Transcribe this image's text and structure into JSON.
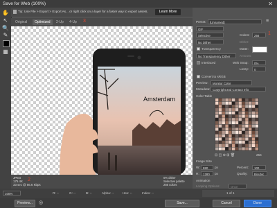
{
  "window": {
    "title": "Save for Web (100%)"
  },
  "tip": {
    "text": "Tip: Use File > Export > Export As... or right click on a layer for a faster way to export assets.",
    "button": "Learn More"
  },
  "tabs": [
    "Original",
    "Optimized",
    "2-Up",
    "4-Up"
  ],
  "annotations": {
    "a1": "3",
    "a2": "2",
    "a3": "1"
  },
  "image": {
    "caption": "Amsterdam"
  },
  "info": {
    "left1": "JPEG",
    "left2": "175.4K",
    "left3": "33 sec @ 56.6 Kbps",
    "right1": "0% dither",
    "right2": "Selective palette",
    "right3": "256 colors"
  },
  "bottom": {
    "zoom": "100%",
    "r": "R: --",
    "g": "G: --",
    "b": "B: --",
    "alpha": "Alpha: --",
    "hex": "Hex: --",
    "index": "Index: --",
    "preview_btn": "Preview...",
    "save_btn": "Save...",
    "cancel_btn": "Cancel",
    "done_btn": "Done"
  },
  "panel": {
    "preset_label": "Preset:",
    "preset_value": "[Unnamed]",
    "format_value": "GIF",
    "reduction_value": "Selective",
    "colors_label": "Colors:",
    "colors_value": "256",
    "dither_value": "No Dither",
    "dither_label": "Dither:",
    "transparency_label": "Transparency",
    "matte_label": "Matte:",
    "transparency_dither_value": "No Transparency Dither",
    "amount_label": "Amount:",
    "interlaced_label": "Interlaced",
    "websnap_label": "Web Snap:",
    "websnap_value": "0%",
    "lossy_label": "Lossy:",
    "lossy_value": "0",
    "srgb_label": "Convert to sRGB",
    "preview_label": "Preview:",
    "preview_value": "Monitor Color",
    "metadata_label": "Metadata:",
    "metadata_value": "Copyright and Contact Info",
    "color_table_label": "Color Table",
    "color_count": "256",
    "image_size_label": "Image Size",
    "w_label": "W:",
    "w_value": "880",
    "h_label": "H:",
    "h_value": "1280",
    "percent_label": "Percent:",
    "percent_value": "100",
    "px_label": "px",
    "quality_label": "Quality:",
    "quality_value": "Bicubic",
    "animation_label": "Animation",
    "looping_label": "Looping Options:",
    "looping_value": "Once",
    "frame_value": "1 of 1"
  }
}
